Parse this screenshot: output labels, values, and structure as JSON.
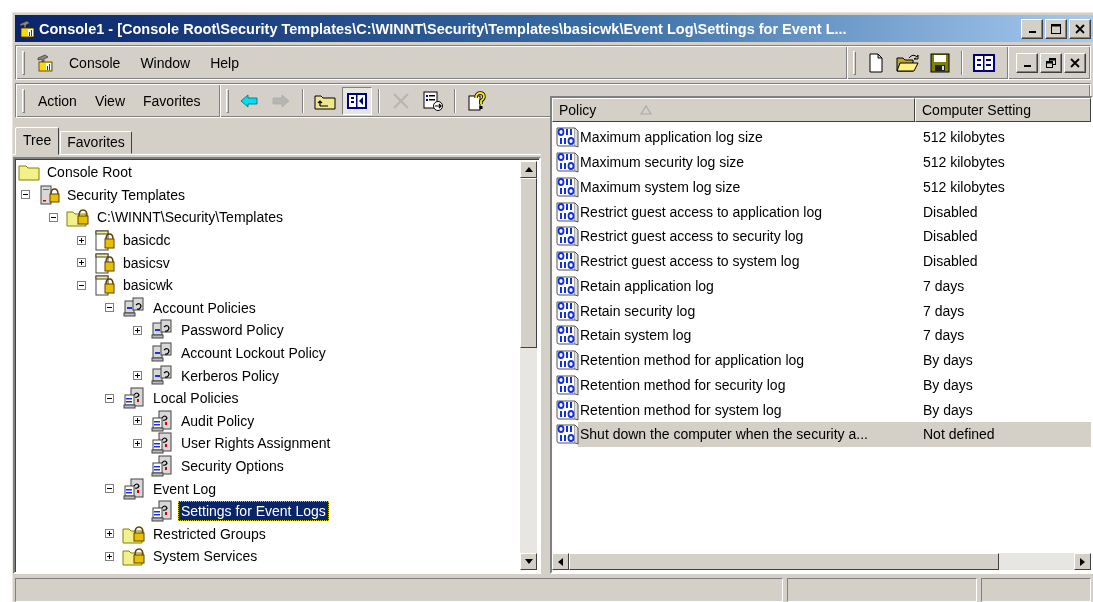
{
  "window": {
    "title": "Console1 - [Console Root\\Security Templates\\C:\\WINNT\\Security\\Templates\\basicwk\\Event Log\\Settings for Event L..."
  },
  "menu_bar": {
    "items": [
      "Console",
      "Window",
      "Help"
    ],
    "toolbar": [
      [
        {
          "kind": "new"
        },
        {
          "kind": "open"
        },
        {
          "kind": "save"
        }
      ],
      [
        {
          "kind": "tree-view"
        }
      ]
    ]
  },
  "action_bar": {
    "items": [
      "Action",
      "View",
      "Favorites"
    ],
    "toolbar": [
      [
        {
          "kind": "back",
          "disabled": false,
          "pressed": false
        },
        {
          "kind": "forward",
          "disabled": true,
          "pressed": false
        }
      ],
      [
        {
          "kind": "up",
          "disabled": false,
          "pressed": false
        },
        {
          "kind": "show-tree",
          "disabled": false,
          "pressed": true
        }
      ],
      [
        {
          "kind": "delete",
          "disabled": true,
          "pressed": false
        },
        {
          "kind": "export",
          "disabled": false,
          "pressed": false
        }
      ],
      [
        {
          "kind": "help",
          "disabled": false,
          "pressed": false
        }
      ]
    ]
  },
  "tabs": [
    {
      "label": "Tree",
      "selected": true
    },
    {
      "label": "Favorites",
      "selected": false
    }
  ],
  "tree": [
    {
      "label": "Console Root",
      "kind": "folder",
      "selected": false,
      "children": [
        {
          "label": "Security Templates",
          "kind": "server-lock",
          "expanded": true,
          "selected": false,
          "children": [
            {
              "label": "C:\\WINNT\\Security\\Templates",
              "kind": "folder-lock",
              "expanded": true,
              "selected": false,
              "children": [
                {
                  "label": "basicdc",
                  "kind": "template",
                  "expanded": false,
                  "selected": false
                },
                {
                  "label": "basicsv",
                  "kind": "template",
                  "expanded": false,
                  "selected": false
                },
                {
                  "label": "basicwk",
                  "kind": "template",
                  "expanded": true,
                  "selected": false,
                  "children": [
                    {
                      "label": "Account Policies",
                      "kind": "policy-group",
                      "expanded": true,
                      "selected": false,
                      "children": [
                        {
                          "label": "Password Policy",
                          "kind": "policy-group",
                          "expanded": false,
                          "selected": false
                        },
                        {
                          "label": "Account Lockout Policy",
                          "kind": "policy-group",
                          "selected": false
                        },
                        {
                          "label": "Kerberos Policy",
                          "kind": "policy-group",
                          "expanded": false,
                          "selected": false
                        }
                      ]
                    },
                    {
                      "label": "Local Policies",
                      "kind": "policy",
                      "expanded": true,
                      "selected": false,
                      "children": [
                        {
                          "label": "Audit Policy",
                          "kind": "policy",
                          "expanded": false,
                          "selected": false
                        },
                        {
                          "label": "User Rights Assignment",
                          "kind": "policy",
                          "expanded": false,
                          "selected": false
                        },
                        {
                          "label": "Security Options",
                          "kind": "policy",
                          "selected": false
                        }
                      ]
                    },
                    {
                      "label": "Event Log",
                      "kind": "policy",
                      "expanded": true,
                      "selected": false,
                      "children": [
                        {
                          "label": "Settings for Event Logs",
                          "kind": "policy",
                          "selected": true
                        }
                      ]
                    },
                    {
                      "label": "Restricted Groups",
                      "kind": "folder-lock",
                      "expanded": false,
                      "selected": false
                    },
                    {
                      "label": "System Services",
                      "kind": "folder-lock",
                      "expanded": false,
                      "selected": false
                    }
                  ]
                }
              ]
            }
          ]
        }
      ]
    }
  ],
  "list": {
    "columns": [
      "Policy",
      "Computer Setting"
    ],
    "rows": [
      {
        "policy": "Maximum application log size",
        "setting": "512 kilobytes",
        "selected": false
      },
      {
        "policy": "Maximum security log size",
        "setting": "512 kilobytes",
        "selected": false
      },
      {
        "policy": "Maximum system log size",
        "setting": "512 kilobytes",
        "selected": false
      },
      {
        "policy": "Restrict guest access to application log",
        "setting": "Disabled",
        "selected": false
      },
      {
        "policy": "Restrict guest access to security log",
        "setting": "Disabled",
        "selected": false
      },
      {
        "policy": "Restrict guest access to system log",
        "setting": "Disabled",
        "selected": false
      },
      {
        "policy": "Retain application log",
        "setting": "7 days",
        "selected": false
      },
      {
        "policy": "Retain security log",
        "setting": "7 days",
        "selected": false
      },
      {
        "policy": "Retain system log",
        "setting": "7 days",
        "selected": false
      },
      {
        "policy": "Retention method for application log",
        "setting": "By days",
        "selected": false
      },
      {
        "policy": "Retention method for security log",
        "setting": "By days",
        "selected": false
      },
      {
        "policy": "Retention method for system log",
        "setting": "By days",
        "selected": false
      },
      {
        "policy": "Shut down the computer when the security a...",
        "setting": "Not defined",
        "selected": true
      }
    ]
  }
}
